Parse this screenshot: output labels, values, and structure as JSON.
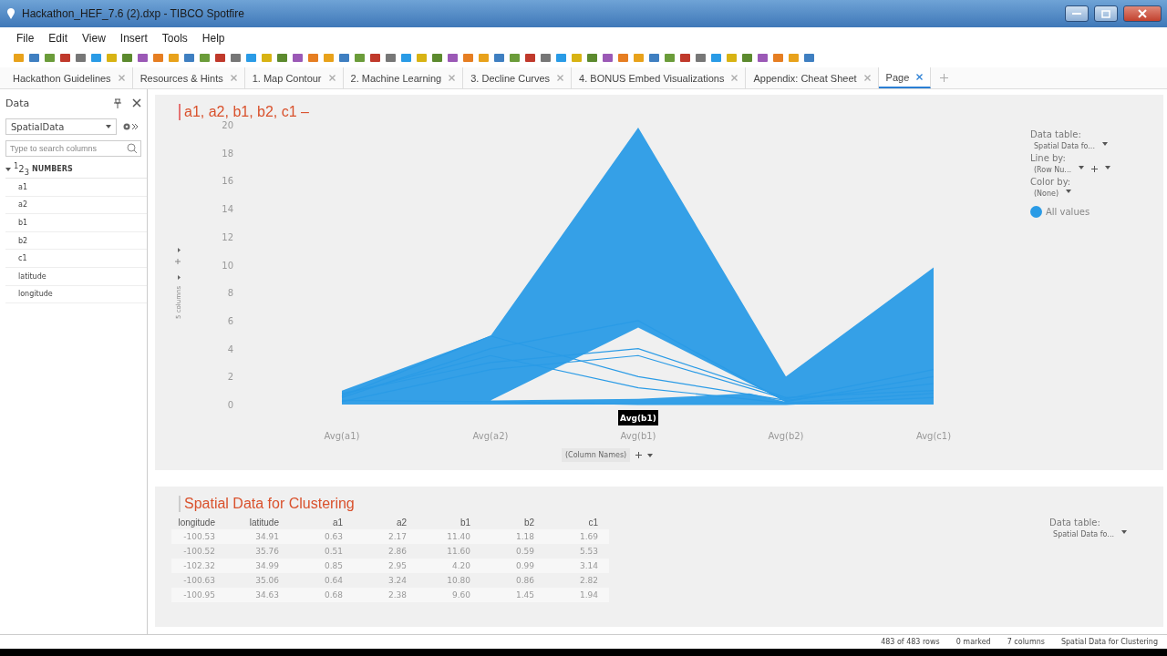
{
  "window": {
    "title": "Hackathon_HEF_7.6 (2).dxp - TIBCO Spotfire"
  },
  "menu": [
    "File",
    "Edit",
    "View",
    "Insert",
    "Tools",
    "Help"
  ],
  "tabs": [
    {
      "label": "Hackathon Guidelines",
      "selected": false
    },
    {
      "label": "Resources & Hints",
      "selected": false
    },
    {
      "label": "1. Map Contour",
      "selected": false
    },
    {
      "label": "2. Machine Learning",
      "selected": false
    },
    {
      "label": "3. Decline Curves",
      "selected": false
    },
    {
      "label": "4. BONUS Embed Visualizations",
      "selected": false
    },
    {
      "label": "Appendix: Cheat Sheet",
      "selected": false
    },
    {
      "label": "Page",
      "selected": true
    }
  ],
  "data_panel": {
    "title": "Data",
    "table": "SpatialData",
    "search": {
      "placeholder": "Type to search columns"
    },
    "group": {
      "type_label": "$^{1}$2$_{3}$",
      "label": "NUMBERS",
      "expanded": true,
      "children": [
        "a1",
        "a2",
        "b1",
        "b2",
        "c1",
        "latitude",
        "longitude"
      ]
    }
  },
  "chart_panel": {
    "title": "a1, a2, b1, b2, c1 –",
    "axis_selector": "5 columns",
    "column_names": "(Column Names)",
    "tooltip": "Avg(b1)",
    "axis_labels": [
      "Avg(a1)",
      "Avg(a2)",
      "Avg(b1)",
      "Avg(b2)",
      "Avg(c1)"
    ],
    "y_tick_labels": [
      "20",
      "18",
      "16",
      "14",
      "12",
      "10",
      "8",
      "6",
      "4",
      "2",
      "0"
    ],
    "legend": {
      "data_table_label": "Data table:",
      "data_table": "Spatial Data fo...",
      "line_by_label": "Line by:",
      "line_by": "(Row Nu...",
      "color_by_label": "Color by:",
      "color_by": "(None)",
      "items": [
        {
          "label": "All values",
          "color": "#2a9be6"
        }
      ]
    }
  },
  "table_panel": {
    "title": "Spatial Data for Clustering",
    "columns": [
      "longitude",
      "latitude",
      "a1",
      "a2",
      "b1",
      "b2",
      "c1"
    ],
    "rows": [
      [
        "-100.53",
        "34.91",
        "0.63",
        "2.17",
        "11.40",
        "1.18",
        "1.69"
      ],
      [
        "-100.52",
        "35.76",
        "0.51",
        "2.86",
        "11.60",
        "0.59",
        "5.53"
      ],
      [
        "-102.32",
        "34.99",
        "0.85",
        "2.95",
        "4.20",
        "0.99",
        "3.14"
      ],
      [
        "-100.63",
        "35.06",
        "0.64",
        "3.24",
        "10.80",
        "0.86",
        "2.82"
      ],
      [
        "-100.95",
        "34.63",
        "0.68",
        "2.38",
        "9.60",
        "1.45",
        "1.94"
      ]
    ],
    "data_table_label": "Data table:",
    "data_table": "Spatial Data fo..."
  },
  "status_bar": [
    "483 of 483 rows",
    "0 marked",
    "7 columns",
    "Spatial Data for Clustering"
  ]
}
